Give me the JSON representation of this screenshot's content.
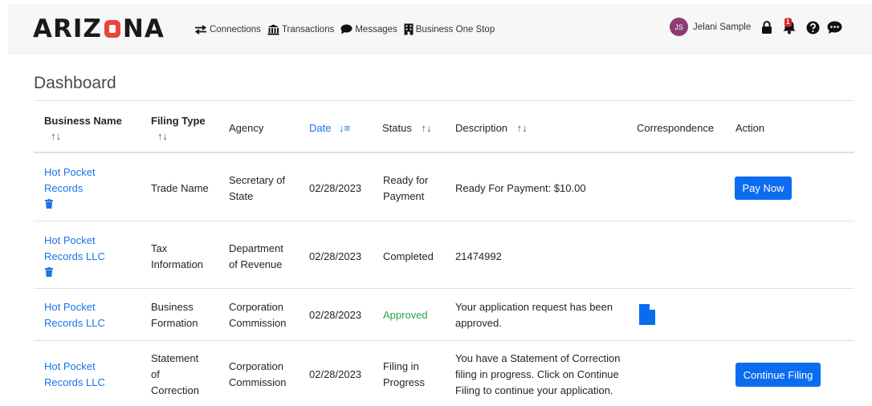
{
  "header": {
    "logo_left": "ARIZ",
    "logo_right": "NA",
    "nav": [
      {
        "label": "Connections",
        "icon": "arrows-exchange-icon"
      },
      {
        "label": "Transactions",
        "icon": "bank-icon"
      },
      {
        "label": "Messages",
        "icon": "speech-bubble-icon"
      },
      {
        "label": "Business One Stop",
        "icon": "building-icon"
      }
    ],
    "user": {
      "initials": "JS",
      "name": "Jelani Sample"
    },
    "notification_count": "1",
    "colors": {
      "avatar": "#8c3b73",
      "logo_sun": "#e8453c",
      "badge": "#d9262e"
    }
  },
  "dashboard": {
    "title": "Dashboard",
    "columns": {
      "business_name": "Business Name",
      "filing_type": "Filing Type",
      "agency": "Agency",
      "date": "Date",
      "status": "Status",
      "description": "Description",
      "correspondence": "Correspondence",
      "action": "Action"
    },
    "sort_glyph": "↑↓",
    "date_sort_glyph": "↓≡",
    "rows": [
      {
        "business": [
          "Hot Pocket",
          "Records"
        ],
        "filing_type": [
          "Trade Name"
        ],
        "agency": [
          "Secretary of",
          "State"
        ],
        "date": "02/28/2023",
        "status": [
          "Ready for",
          "Payment"
        ],
        "description": [
          "Ready For Payment: $10.00"
        ],
        "action": "Pay Now",
        "has_delete": true
      },
      {
        "business": [
          "Hot Pocket",
          "Records LLC"
        ],
        "filing_type": [
          "Tax",
          "Information"
        ],
        "agency": [
          "Department",
          "of Revenue"
        ],
        "date": "02/28/2023",
        "status": [
          "Completed"
        ],
        "description": [
          "21474992"
        ],
        "action": "",
        "has_delete": true
      },
      {
        "business": [
          "Hot Pocket",
          "Records LLC"
        ],
        "filing_type": [
          "Business",
          "Formation"
        ],
        "agency": [
          "Corporation",
          "Commission"
        ],
        "date": "02/28/2023",
        "status": [
          "Approved"
        ],
        "description": [
          "Your application request has been",
          "approved."
        ],
        "correspondence_icon": "document-icon",
        "action": ""
      },
      {
        "business": [
          "Hot Pocket",
          "Records LLC"
        ],
        "filing_type": [
          "Statement",
          "of",
          "Correction"
        ],
        "agency": [
          "Corporation",
          "Commission"
        ],
        "date": "02/28/2023",
        "status": [
          "Filing in",
          "Progress"
        ],
        "description": [
          "You have a Statement of Correction",
          "filing in progress. Click on Continue",
          "Filing to continue your application."
        ],
        "action": "Continue Filing"
      }
    ]
  }
}
